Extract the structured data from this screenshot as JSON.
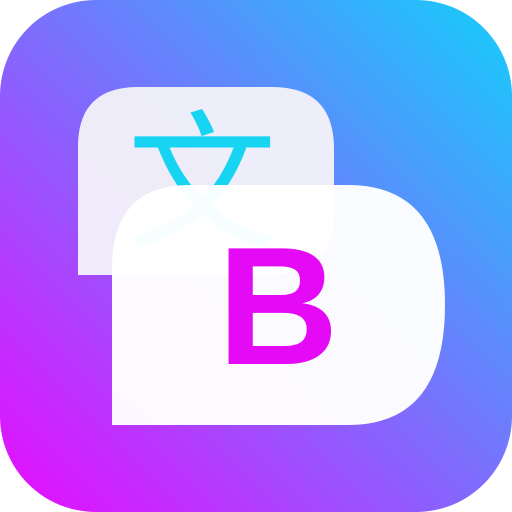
{
  "icon": {
    "name": "translate-app-icon",
    "source_glyph": "文",
    "target_letter": "B"
  },
  "colors": {
    "gradient_top_right": "#13CFFB",
    "gradient_bottom_left": "#E80BFF",
    "back_bubble": "#F4F1FA",
    "front_bubble": "#FFFFFF",
    "glyph_color": "#16D4F2",
    "letter_color": "#E40AF5"
  }
}
